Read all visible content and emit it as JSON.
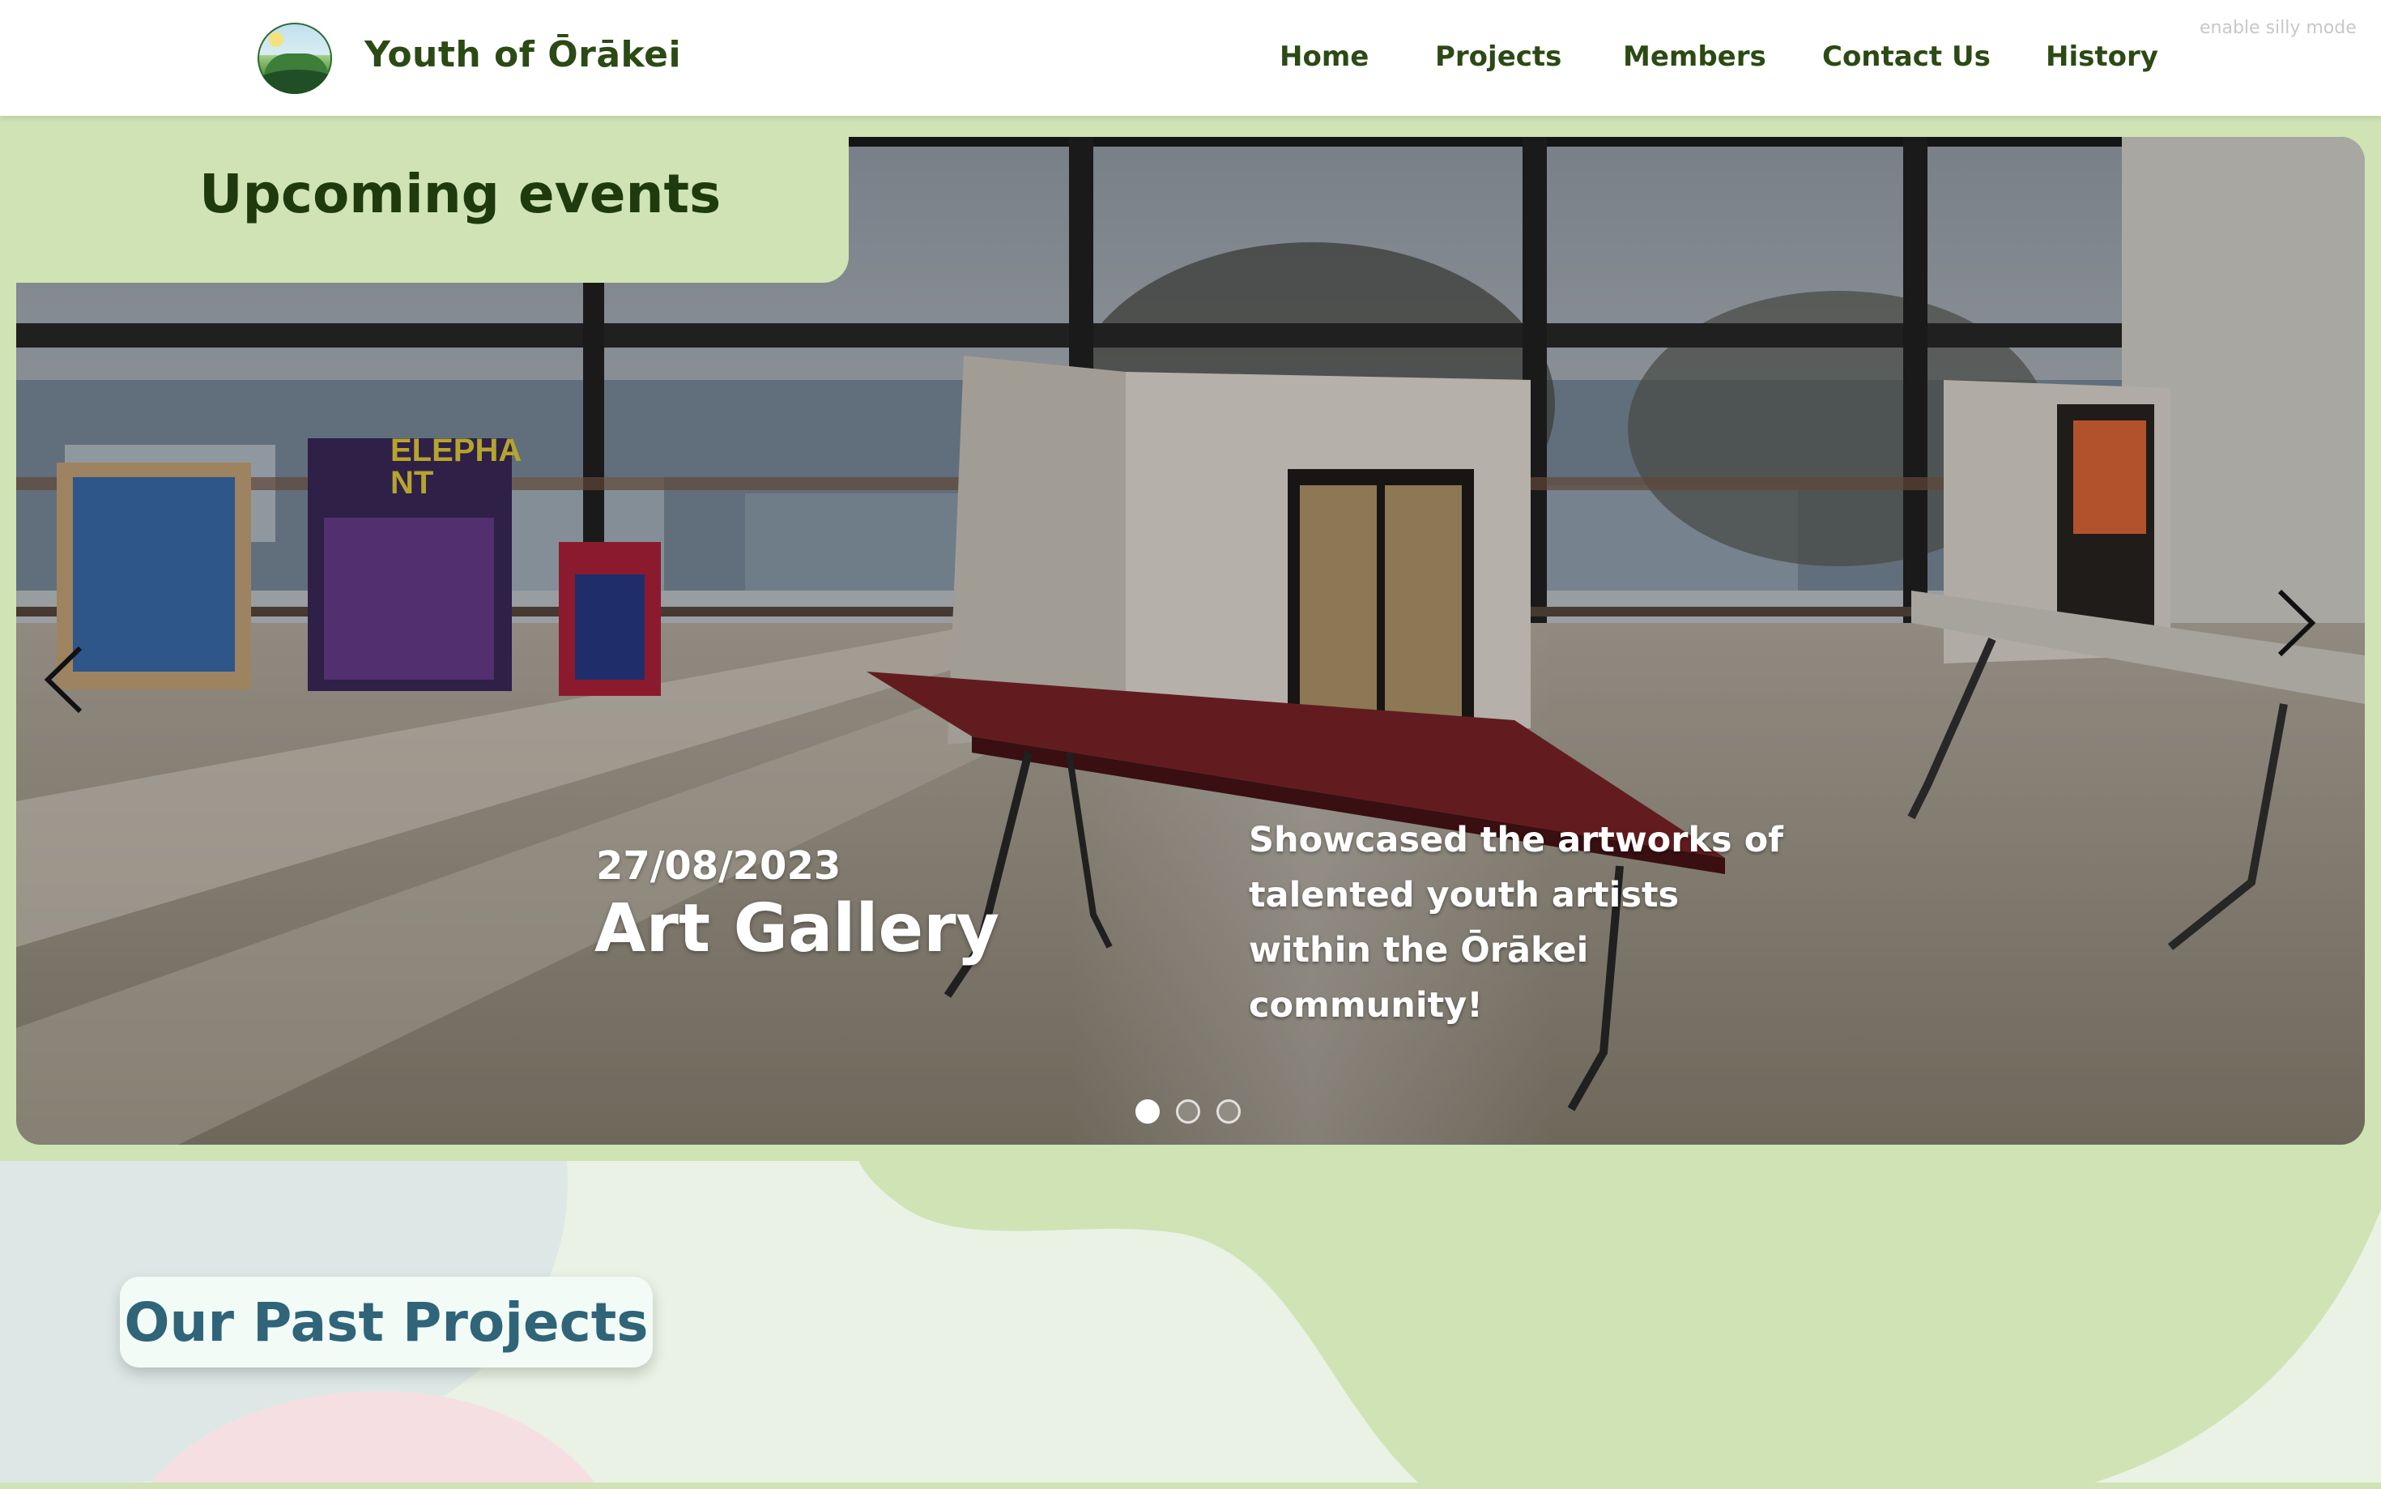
{
  "header": {
    "site_title": "Youth of Ōrākei",
    "silly_mode": "enable silly mode",
    "nav": [
      {
        "label": "Home"
      },
      {
        "label": "Projects"
      },
      {
        "label": "Members"
      },
      {
        "label": "Contact Us"
      },
      {
        "label": "History"
      }
    ]
  },
  "events": {
    "heading": "Upcoming events",
    "slide": {
      "date": "27/08/2023",
      "title": "Art Gallery",
      "description": "Showcased the artworks of talented youth artists within the Ōrākei community!",
      "poster_text": "ELEPHANT"
    },
    "slide_count": 3,
    "active_slide": 1
  },
  "projects": {
    "heading": "Our Past Projects"
  },
  "colors": {
    "brand_green": "#2c4a14",
    "band_green": "#cfe3b5",
    "page_bg": "#e9f2e4",
    "projects_heading": "#2f6479"
  },
  "icons": {
    "prev": "chevron-left-icon",
    "next": "chevron-right-icon",
    "logo": "hills-sun-logo"
  }
}
